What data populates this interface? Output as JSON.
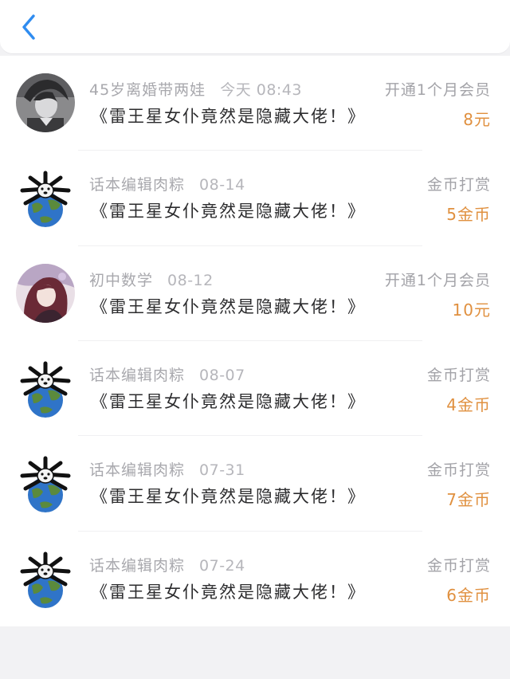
{
  "header": {
    "back_icon": "chevron-left-icon",
    "accent_color": "#2f8cf0"
  },
  "records": [
    {
      "user": "45岁离婚带两娃",
      "time": "今天 08:43",
      "book": "《雷王星女仆竟然是隐藏大佬！》",
      "action": "开通1个月会员",
      "amount": "8元",
      "avatar": "anime-boy-avatar"
    },
    {
      "user": "话本编辑肉粽",
      "time": "08-14",
      "book": "《雷王星女仆竟然是隐藏大佬！》",
      "action": "金币打赏",
      "amount": "5金币",
      "avatar": "globe-dog-avatar"
    },
    {
      "user": "初中数学",
      "time": "08-12",
      "book": "《雷王星女仆竟然是隐藏大佬！》",
      "action": "开通1个月会员",
      "amount": "10元",
      "avatar": "anime-girl-avatar"
    },
    {
      "user": "话本编辑肉粽",
      "time": "08-07",
      "book": "《雷王星女仆竟然是隐藏大佬！》",
      "action": "金币打赏",
      "amount": "4金币",
      "avatar": "globe-dog-avatar"
    },
    {
      "user": "话本编辑肉粽",
      "time": "07-31",
      "book": "《雷王星女仆竟然是隐藏大佬！》",
      "action": "金币打赏",
      "amount": "7金币",
      "avatar": "globe-dog-avatar"
    },
    {
      "user": "话本编辑肉粽",
      "time": "07-24",
      "book": "《雷王星女仆竟然是隐藏大佬！》",
      "action": "金币打赏",
      "amount": "6金币",
      "avatar": "globe-dog-avatar"
    }
  ]
}
